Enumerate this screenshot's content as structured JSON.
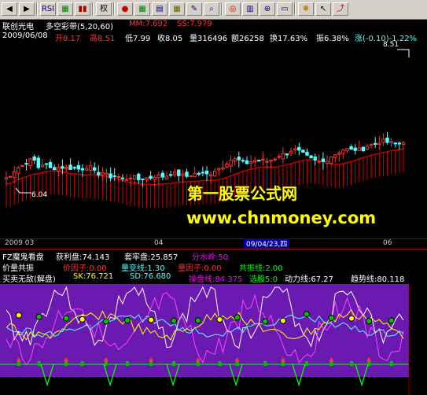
{
  "toolbar": {
    "items": [
      {
        "name": "back-icon",
        "label": "◀",
        "color": "#000000"
      },
      {
        "name": "forward-icon",
        "label": "▶",
        "color": "#000000"
      },
      {
        "name": "rsi-button",
        "label": "RSI",
        "color": "#000080"
      },
      {
        "name": "indicator-icon",
        "label": "▦",
        "color": "#008000"
      },
      {
        "name": "bars-icon",
        "label": "▮▮",
        "color": "#a00000"
      },
      {
        "name": "rights-button",
        "label": "权",
        "color": "#000000"
      },
      {
        "name": "record-icon",
        "label": "●",
        "color": "#c00000"
      },
      {
        "name": "grid-icon",
        "label": "▦",
        "color": "#008000"
      },
      {
        "name": "layout-icon",
        "label": "▤",
        "color": "#000080"
      },
      {
        "name": "table-icon",
        "label": "▦",
        "color": "#606000"
      },
      {
        "name": "pen-icon",
        "label": "✎",
        "color": "#000080"
      },
      {
        "name": "find-icon",
        "label": "⌕",
        "color": "#000080"
      },
      {
        "name": "target-icon",
        "label": "◎",
        "color": "#c00000"
      },
      {
        "name": "lock-icon",
        "label": "▥",
        "color": "#000080"
      },
      {
        "name": "zoom-icon",
        "label": "⊕",
        "color": "#000080"
      },
      {
        "name": "window-icon",
        "label": "▭",
        "color": "#000080"
      },
      {
        "name": "refresh-icon",
        "label": "✱",
        "color": "#c08000"
      },
      {
        "name": "cursor-icon",
        "label": "↖",
        "color": "#000000"
      },
      {
        "name": "exit-icon",
        "label": "⤴",
        "color": "#c00000"
      }
    ]
  },
  "header": {
    "stock_name": "联创光电",
    "indicator": "多空彩带(5,20,60)",
    "mm_label": "MM:7.692",
    "ss_label": "SS:7.979"
  },
  "quote": {
    "date": "2009/06/08",
    "open": "开8.17",
    "high": "高8.51",
    "low": "低7.99",
    "close": "收8.05",
    "volume": "量316496",
    "amount": "额26258",
    "turnover": "换17.63%",
    "amplitude": "振6.38%",
    "change": "涨(-0.10)-1.22%",
    "price_high_mark": "8.51",
    "price_low_mark": "6.04"
  },
  "watermark": {
    "line1": "第一股票公式网",
    "line2": "www.chnmoney.com"
  },
  "time_axis": {
    "labels": [
      "2009 03",
      "04",
      "09/04/23,四",
      "06"
    ]
  },
  "panel1": {
    "name": "FZ魔鬼看盘",
    "profit": "获利盘:74.143",
    "trapped": "套牢盘:25.857",
    "watershed": "分水岭:50",
    "price_vol": "价量共振",
    "price_factor": "价因子:0.00",
    "vol_line": "量变线:1.30",
    "vol_factor": "量因子:0.00",
    "resonance": "共振线:2.00"
  },
  "panel2": {
    "name": "买卖无敌(解盘)",
    "sk": "SK:76.721",
    "sd": "SD:76.680",
    "operation": "操盘线:84.375",
    "select": "选股5:0",
    "power": "动力线:67.27",
    "trend": "趋势线:80.118"
  },
  "colors": {
    "up": "#ff3232",
    "down": "#54ffff",
    "ma": "#c80000",
    "axis": "#a00000",
    "white_text": "#ffffff",
    "yellow_text": "#ffff00",
    "magenta_text": "#ff00ff",
    "green_text": "#00ff00",
    "purple_band": "#6a1ab0"
  }
}
